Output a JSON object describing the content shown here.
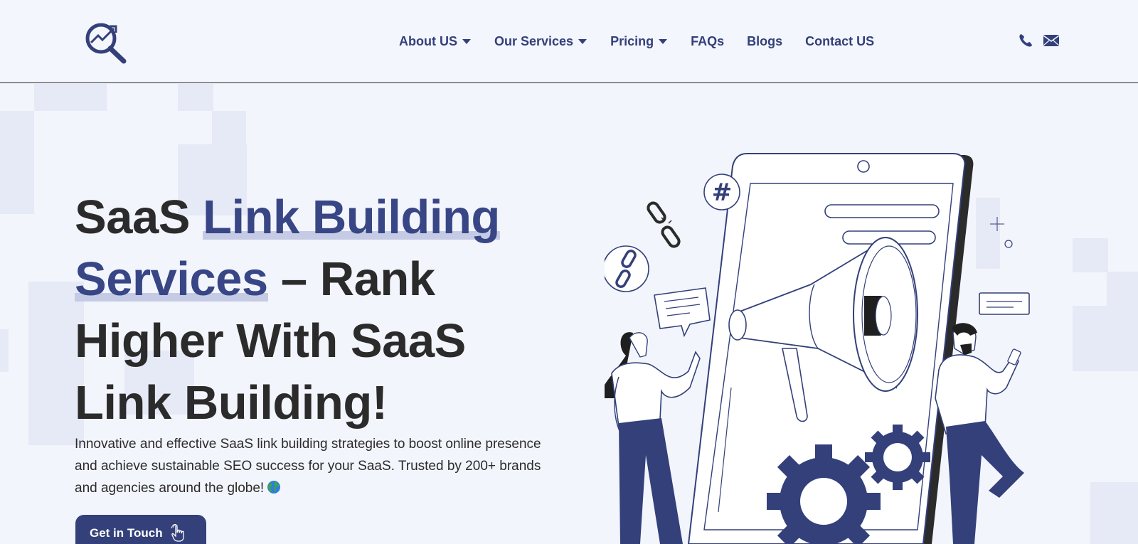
{
  "nav": {
    "items": [
      {
        "label": "About US",
        "dropdown": true
      },
      {
        "label": "Our Services",
        "dropdown": true
      },
      {
        "label": "Pricing",
        "dropdown": true
      },
      {
        "label": "FAQs",
        "dropdown": false
      },
      {
        "label": "Blogs",
        "dropdown": false
      },
      {
        "label": "Contact US",
        "dropdown": false
      }
    ]
  },
  "hero": {
    "title_part1": "SaaS ",
    "title_highlight1": "Link Building",
    "title_highlight2": "Services",
    "title_part2": " – Rank Higher With SaaS Link Building!",
    "description": "Innovative and effective SaaS link building strategies to boost online presence and achieve sustainable SEO success for your SaaS. Trusted by 200+ brands and agencies around the globe!",
    "cta_label": "Get in Touch"
  },
  "icons": {
    "logo": "magnifier-trend-logo",
    "phone": "phone-icon",
    "mail": "mail-icon",
    "globe": "globe-emoji-icon",
    "cta": "pointing-hand-icon"
  },
  "colors": {
    "primary": "#33407a",
    "accent": "#384685",
    "text": "#2b2b2b",
    "background": "#f3f5fc"
  }
}
